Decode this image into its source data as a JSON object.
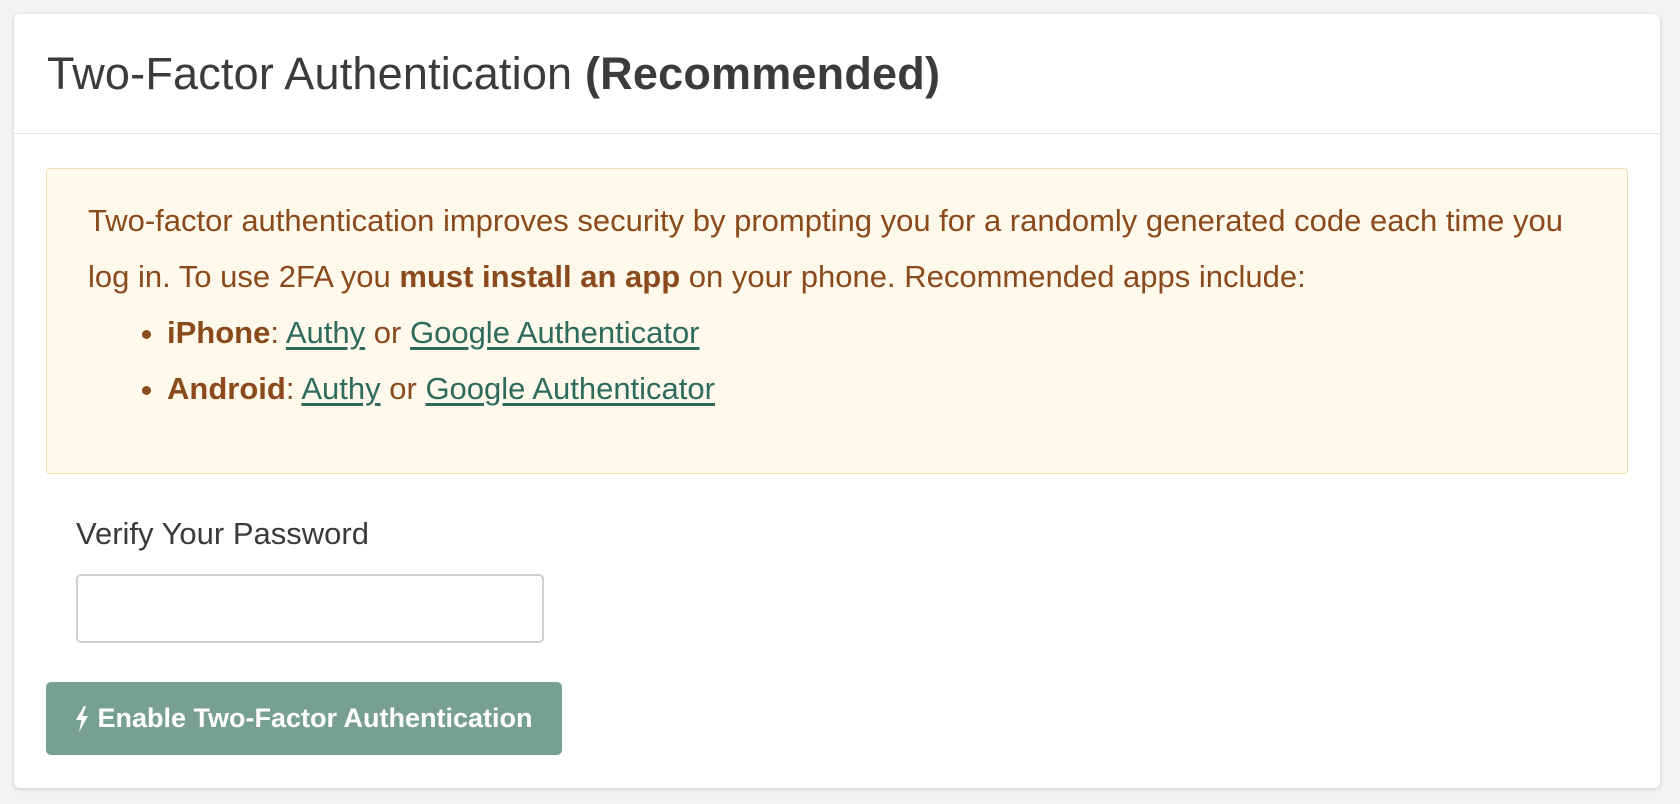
{
  "header": {
    "title_main": "Two-Factor Authentication",
    "title_paren": "(Recommended)"
  },
  "alert": {
    "text_before": "Two-factor authentication improves security by prompting you for a randomly generated code each time you log in. To use 2FA you ",
    "text_strong": "must install an app",
    "text_after": " on your phone. Recommended apps include:",
    "platforms": [
      {
        "name": "iPhone",
        "app1": "Authy",
        "separator": "or",
        "app2": "Google Authenticator"
      },
      {
        "name": "Android",
        "app1": "Authy",
        "separator": "or",
        "app2": "Google Authenticator"
      }
    ]
  },
  "form": {
    "password_label": "Verify Your Password",
    "password_value": "",
    "password_placeholder": ""
  },
  "button": {
    "icon": "bolt-icon",
    "label": "Enable Two-Factor Authentication"
  },
  "colors": {
    "alert_bg": "#fef9eb",
    "alert_text": "#8a4a1c",
    "link": "#2e6b5c",
    "button_bg": "#789f94"
  }
}
